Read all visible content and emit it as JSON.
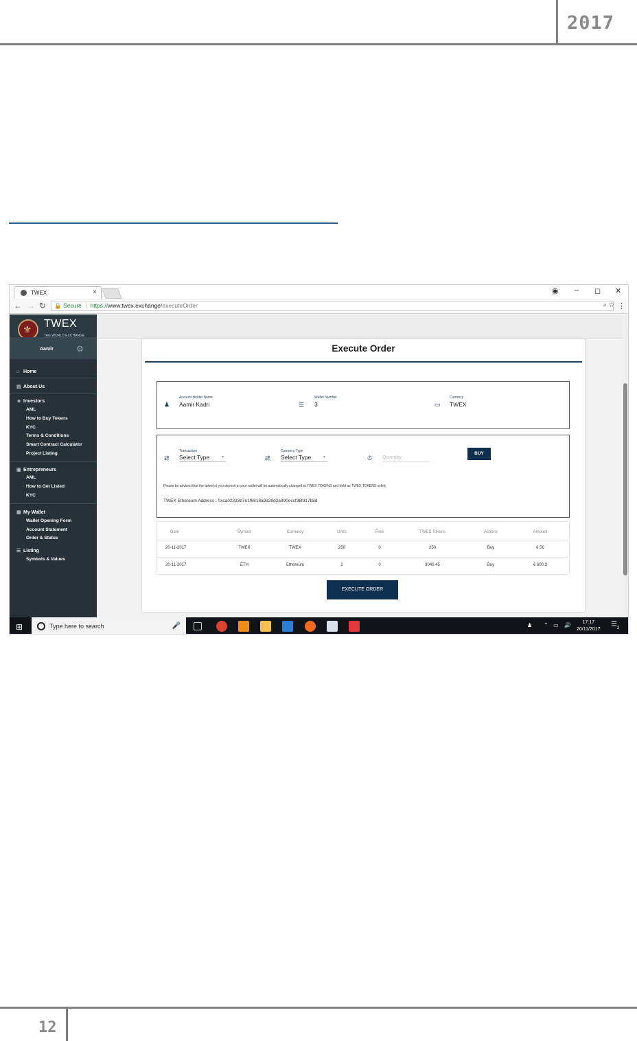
{
  "document": {
    "year": "2017",
    "page_number": "12"
  },
  "browser": {
    "tab_title": "TWEX",
    "tab_close": "×",
    "window_controls": [
      "–",
      "◻",
      "✕"
    ],
    "secure_label": "Secure",
    "url_protocol": "https://",
    "url_host": "www.twex.exchange",
    "url_path": "/executeOrder"
  },
  "sidebar": {
    "brand_name": "TWEX",
    "brand_tagline": "TAG WORLD EXCHANGE",
    "user_name": "Aamir",
    "home": "Home",
    "about": "About Us",
    "investors": {
      "title": "Investors",
      "items": [
        "AML",
        "How to Buy Tokens",
        "KYC",
        "Terms & Conditions",
        "Smart Contract Calculator",
        "Project Listing"
      ]
    },
    "entrepreneurs": {
      "title": "Entrepreneurs",
      "items": [
        "AML",
        "How to Get Listed",
        "KYC"
      ]
    },
    "wallet": {
      "title": "My Wallet",
      "items": [
        "Wallet Opening Form",
        "Account Statement",
        "Order & Status"
      ]
    },
    "listing": {
      "title": "Listing",
      "items": [
        "Symbols & Values"
      ]
    }
  },
  "main": {
    "title": "Execute Order",
    "account": {
      "holder_label": "Account Holder Name",
      "holder_value": "Aamir Kadri",
      "wallet_label": "Wallet Number",
      "wallet_value": "3",
      "currency_label": "Currency",
      "currency_value": "TWEX"
    },
    "order": {
      "transaction_label": "Transaction",
      "transaction_value": "Select Type",
      "currency_type_label": "Currency Type",
      "currency_type_value": "Select Type",
      "quantity_placeholder": "Quantity",
      "buy_label": "BUY",
      "notice": "Please be advised that the token(s) you deposit in your wallet will be automatically changed to TWEX TOKENS and held as TWEX TOKENS solely",
      "eth_address": "TWEX Ethereum Address : 0xca02333d7e1f6818a9a29d2a990eccf36fd17b8d"
    },
    "table": {
      "headers": [
        "Date",
        "Symbol",
        "Currency",
        "Units",
        "Fees",
        "TWEX Tokens",
        "Actions",
        "Amount"
      ],
      "rows": [
        [
          "20-11-2017",
          "TWEX",
          "TWEX",
          "250",
          "0",
          "250",
          "Buy",
          "€ 50"
        ],
        [
          "20-11-2017",
          "ETH",
          "Ethereum",
          "2",
          "0",
          "3040.45",
          "Buy",
          "€ 600.3"
        ]
      ]
    },
    "execute_label": "EXECUTE ORDER"
  },
  "taskbar": {
    "search_placeholder": "Type here to search",
    "time": "17:17",
    "date": "20/11/2017",
    "notification_count": "2"
  }
}
